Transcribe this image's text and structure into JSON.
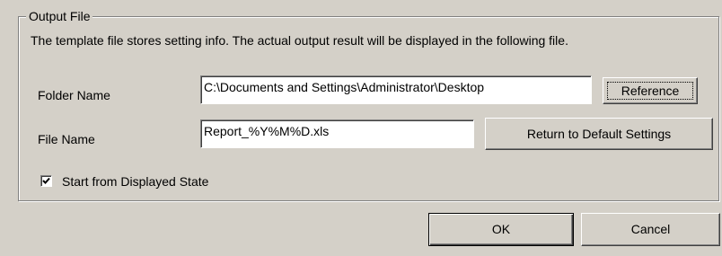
{
  "group": {
    "title": "Output File",
    "description": "The template file stores setting info. The actual output result will be displayed in the following file."
  },
  "folder": {
    "label": "Folder Name",
    "value": "C:\\Documents and Settings\\Administrator\\Desktop",
    "reference_button": "Reference"
  },
  "file": {
    "label": "File Name",
    "value": "Report_%Y%M%D.xls",
    "default_button": "Return to Default Settings"
  },
  "start_displayed": {
    "label": "Start from Displayed State",
    "checked": true
  },
  "dialog": {
    "ok": "OK",
    "cancel": "Cancel"
  }
}
